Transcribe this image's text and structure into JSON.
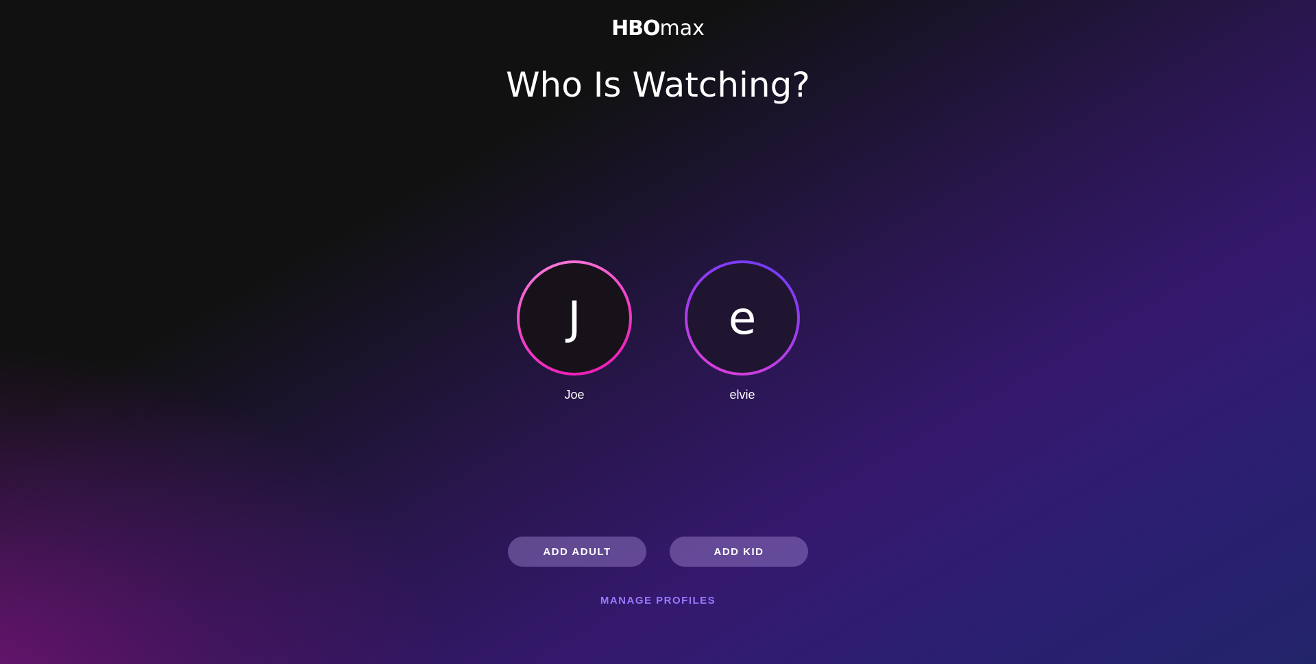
{
  "brand": {
    "logo_hbo": "HBO",
    "logo_max": "max",
    "logo_icon": "hbomax-logo"
  },
  "header": {
    "title": "Who Is Watching?"
  },
  "profiles": [
    {
      "initial": "J",
      "name": "Joe",
      "ring_colors": [
        "#f585d8",
        "#ee17b4"
      ]
    },
    {
      "initial": "e",
      "name": "elvie",
      "ring_colors": [
        "#e13fd5",
        "#6a3cf5"
      ]
    }
  ],
  "actions": {
    "add_adult": "ADD ADULT",
    "add_kid": "ADD KID",
    "manage_profiles": "MANAGE PROFILES"
  },
  "colors": {
    "accent": "#9a78ff",
    "button_bg": "#6b5694"
  }
}
